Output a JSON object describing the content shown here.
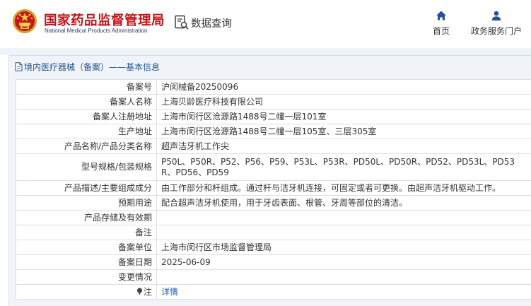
{
  "header": {
    "brand_cn": "国家药品监督管理局",
    "brand_en": "National Medical Products Administration",
    "query_label": "数据查询",
    "nav": [
      {
        "label": "首页",
        "icon": "home-icon"
      },
      {
        "label": "政务服务门户",
        "icon": "user-icon"
      }
    ]
  },
  "panel": {
    "title": "境内医疗器械（备案）——基本信息"
  },
  "rows": [
    {
      "key": "备案号",
      "value": "沪闵械备20250096"
    },
    {
      "key": "备案人名称",
      "value": "上海贝龄医疗科技有限公司"
    },
    {
      "key": "备案人注册地址",
      "value": "上海市闵行区沧源路1488号二幢一层101室"
    },
    {
      "key": "生产地址",
      "value": "上海市闵行区沧源路1488号二幢一层105室、三层305室"
    },
    {
      "key": "产品名称/产品分类名称",
      "value": "超声洁牙机工作尖"
    },
    {
      "key": "型号规格/包装规格",
      "value": "P50L、P50R、P52、P56、P59、P53L、P53R、PD50L、PD50R、PD52、PD53L、PD53R、PD56、PD59"
    },
    {
      "key": "产品描述/主要组成成分",
      "value": "由工作部分和杆组成。通过杆与洁牙机连接，可固定或者可更换。由超声洁牙机驱动工作。"
    },
    {
      "key": "预期用途",
      "value": "配合超声洁牙机使用，用于牙齿表面、根管、牙周等部位的清洁。"
    },
    {
      "key": "产品存储及有效期",
      "value": ""
    },
    {
      "key": "备注",
      "value": ""
    },
    {
      "key": "备案单位",
      "value": "上海市闵行区市场监督管理局"
    },
    {
      "key": "备案日期",
      "value": "2025-06-09"
    },
    {
      "key": "变更情况",
      "value": ""
    },
    {
      "key": "注",
      "value": "详情"
    }
  ],
  "colors": {
    "brand_red": "#c2151b",
    "title_blue": "#1f4f8c",
    "link_blue": "#1f5fb3",
    "panel_bg": "#f0f4f8"
  }
}
